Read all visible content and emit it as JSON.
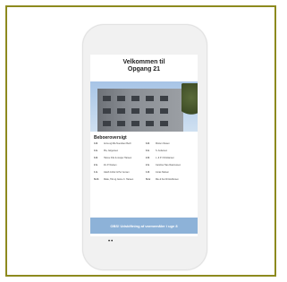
{
  "welcome": {
    "line1": "Velkommen til",
    "line2": "Opgang 21"
  },
  "residents": {
    "title": "Beboeroversigt",
    "items": [
      {
        "apt": "4.th",
        "name": "Anna og Mia Svendsen Bech"
      },
      {
        "apt": "3.th",
        "name": "Morten Olesen"
      },
      {
        "apt": "4.tv",
        "name": "Pia, Jørgensen"
      },
      {
        "apt": "3.tv",
        "name": "S. Andersen"
      },
      {
        "apt": "3.th",
        "name": "Hanne Friis & Jesper Hansen"
      },
      {
        "apt": "2.th",
        "name": "L. & P. Christiansen"
      },
      {
        "apt": "2.tv",
        "name": "Iris P. Nielsen"
      },
      {
        "apt": "2.tv",
        "name": "Caroline Hare Rasmussen"
      },
      {
        "apt": "1.tv",
        "name": "Jakob Juhler & Per Jensen"
      },
      {
        "apt": "1.th",
        "name": "Jonas Nielsen"
      },
      {
        "apt": "St.th",
        "name": "Malte, Tiki og Janne C. Hansen"
      },
      {
        "apt": "St.tv",
        "name": "Mie & Kai Christoffersen"
      }
    ]
  },
  "banner": {
    "label": "OBS! Udskiftning af varmemåler i uge 8"
  },
  "dots": "••"
}
